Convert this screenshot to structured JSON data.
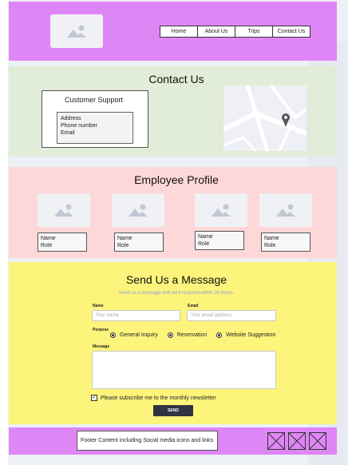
{
  "header": {
    "logo_icon": "image-placeholder-icon",
    "nav": [
      "Home",
      "About Us",
      "Trips",
      "Contact Us"
    ]
  },
  "contact": {
    "title": "Contact Us",
    "support_title": "Customer Support",
    "lines": [
      "Address",
      "Phone number",
      "Email"
    ],
    "map_icon": "map-pin-icon"
  },
  "employees": {
    "title": "Employee Profile",
    "cards": [
      {
        "name": "Name",
        "role": "Role"
      },
      {
        "name": "Name",
        "role": "Role"
      },
      {
        "name": "Name",
        "role": "Role"
      },
      {
        "name": "Name",
        "role": "Role"
      }
    ]
  },
  "message": {
    "title": "Send Us a Message",
    "subtitle": "Send us a message and we'll respond within 24 hours.",
    "name_label": "Name",
    "name_placeholder": "Your name",
    "email_label": "Email",
    "email_placeholder": "Your email address",
    "purpose_label": "Purpose",
    "purposes": [
      "General Inquiry",
      "Reservation",
      "Website Suggestion"
    ],
    "message_label": "Message",
    "newsletter_label": "Please subscribe me to the monthly newsletter",
    "newsletter_checked": true,
    "send_label": "SEND"
  },
  "footer": {
    "text": "Footer Content including Social media icons and links"
  },
  "colors": {
    "header": "#df86f6",
    "contact": "#e1ecd9",
    "employee": "#fed8d8",
    "message": "#fdf47c",
    "button": "#2f3440"
  }
}
